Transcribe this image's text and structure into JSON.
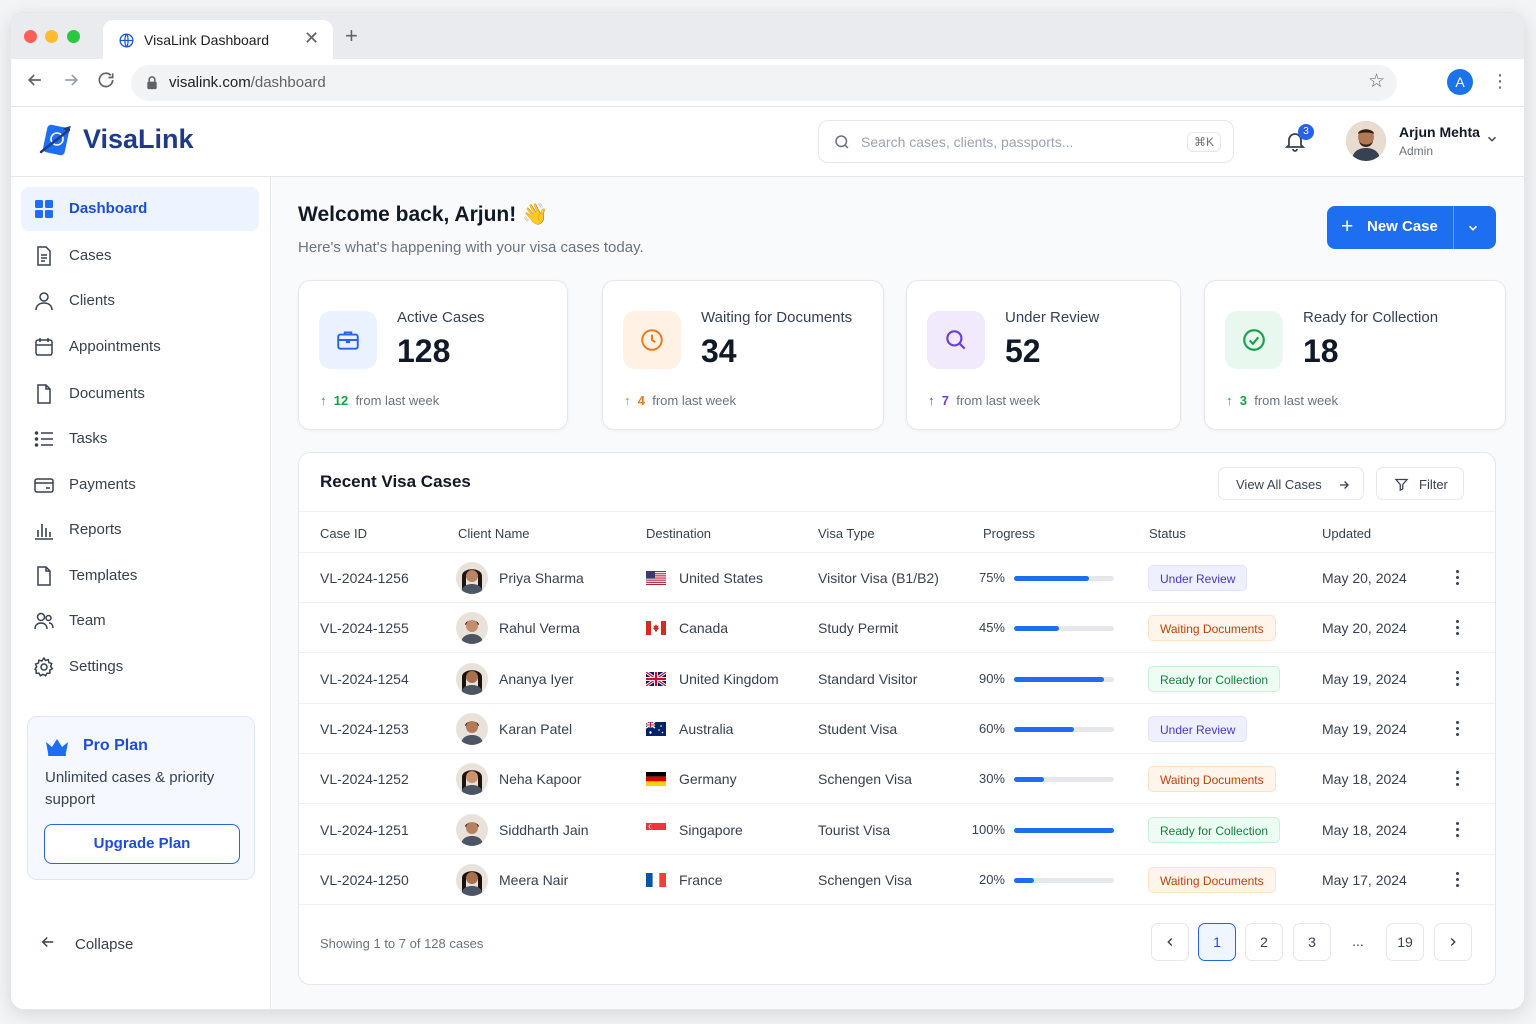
{
  "browser": {
    "tab_title": "VisaLink Dashboard",
    "url_domain": "visalink.com",
    "url_path": "/dashboard",
    "profile_initial": "A"
  },
  "header": {
    "brand": "VisaLink",
    "search_placeholder": "Search cases, clients, passports...",
    "search_shortcut": "⌘K",
    "notification_count": "3",
    "user_name": "Arjun Mehta",
    "user_role": "Admin"
  },
  "sidebar": {
    "items": [
      {
        "label": "Dashboard",
        "icon": "dashboard-icon"
      },
      {
        "label": "Cases",
        "icon": "cases-icon"
      },
      {
        "label": "Clients",
        "icon": "user-icon"
      },
      {
        "label": "Appointments",
        "icon": "calendar-icon"
      },
      {
        "label": "Documents",
        "icon": "document-icon"
      },
      {
        "label": "Tasks",
        "icon": "list-icon"
      },
      {
        "label": "Payments",
        "icon": "card-icon"
      },
      {
        "label": "Reports",
        "icon": "chart-icon"
      },
      {
        "label": "Templates",
        "icon": "template-icon"
      },
      {
        "label": "Team",
        "icon": "team-icon"
      },
      {
        "label": "Settings",
        "icon": "gear-icon"
      }
    ],
    "pro": {
      "title": "Pro Plan",
      "description": "Unlimited cases & priority support",
      "button": "Upgrade Plan"
    },
    "collapse": "Collapse"
  },
  "main": {
    "welcome": "Welcome back, Arjun! 👋",
    "subtitle": "Here's what's happening with your visa cases today.",
    "new_case": "New Case",
    "stats": [
      {
        "title": "Active Cases",
        "value": "128",
        "delta": "12",
        "delta_text": "from last week",
        "color": "#2563eb",
        "bg": "#eaf2ff"
      },
      {
        "title": "Waiting for Documents",
        "value": "34",
        "delta": "4",
        "delta_text": "from last week",
        "color": "#ea7a1b",
        "bg": "#fff2e5"
      },
      {
        "title": "Under Review",
        "value": "52",
        "delta": "7",
        "delta_text": "from last week",
        "color": "#6d3fd6",
        "bg": "#f1eafd"
      },
      {
        "title": "Ready for Collection",
        "value": "18",
        "delta": "3",
        "delta_text": "from last week",
        "color": "#16a34a",
        "bg": "#e8f8ee"
      }
    ],
    "table": {
      "title": "Recent Visa Cases",
      "view_all": "View All Cases",
      "filter": "Filter",
      "columns": [
        "Case ID",
        "Client Name",
        "Destination",
        "Visa Type",
        "Progress",
        "Status",
        "Updated"
      ],
      "rows": [
        {
          "id": "VL-2024-1256",
          "client": "Priya Sharma",
          "dest": "United States",
          "flag": "us",
          "visa": "Visitor Visa (B1/B2)",
          "progress": 75,
          "progress_label": "75%",
          "status": "Under Review",
          "status_kind": "review",
          "updated": "May 20, 2024"
        },
        {
          "id": "VL-2024-1255",
          "client": "Rahul Verma",
          "dest": "Canada",
          "flag": "ca",
          "visa": "Study Permit",
          "progress": 45,
          "progress_label": "45%",
          "status": "Waiting Documents",
          "status_kind": "waiting",
          "updated": "May 20, 2024"
        },
        {
          "id": "VL-2024-1254",
          "client": "Ananya Iyer",
          "dest": "United Kingdom",
          "flag": "uk",
          "visa": "Standard Visitor",
          "progress": 90,
          "progress_label": "90%",
          "status": "Ready for Collection",
          "status_kind": "ready",
          "updated": "May 19, 2024"
        },
        {
          "id": "VL-2024-1253",
          "client": "Karan Patel",
          "dest": "Australia",
          "flag": "au",
          "visa": "Student Visa",
          "progress": 60,
          "progress_label": "60%",
          "status": "Under Review",
          "status_kind": "review",
          "updated": "May 19, 2024"
        },
        {
          "id": "VL-2024-1252",
          "client": "Neha Kapoor",
          "dest": "Germany",
          "flag": "de",
          "visa": "Schengen Visa",
          "progress": 30,
          "progress_label": "30%",
          "status": "Waiting Documents",
          "status_kind": "waiting",
          "updated": "May 18, 2024"
        },
        {
          "id": "VL-2024-1251",
          "client": "Siddharth Jain",
          "dest": "Singapore",
          "flag": "sg",
          "visa": "Tourist Visa",
          "progress": 100,
          "progress_label": "100%",
          "status": "Ready for Collection",
          "status_kind": "ready",
          "updated": "May 18, 2024"
        },
        {
          "id": "VL-2024-1250",
          "client": "Meera Nair",
          "dest": "France",
          "flag": "fr",
          "visa": "Schengen Visa",
          "progress": 20,
          "progress_label": "20%",
          "status": "Waiting Documents",
          "status_kind": "waiting",
          "updated": "May 17, 2024"
        }
      ],
      "showing": "Showing 1 to 7 of 128 cases",
      "pages": [
        "1",
        "2",
        "3",
        "...",
        "19"
      ],
      "current_page": "1"
    }
  }
}
